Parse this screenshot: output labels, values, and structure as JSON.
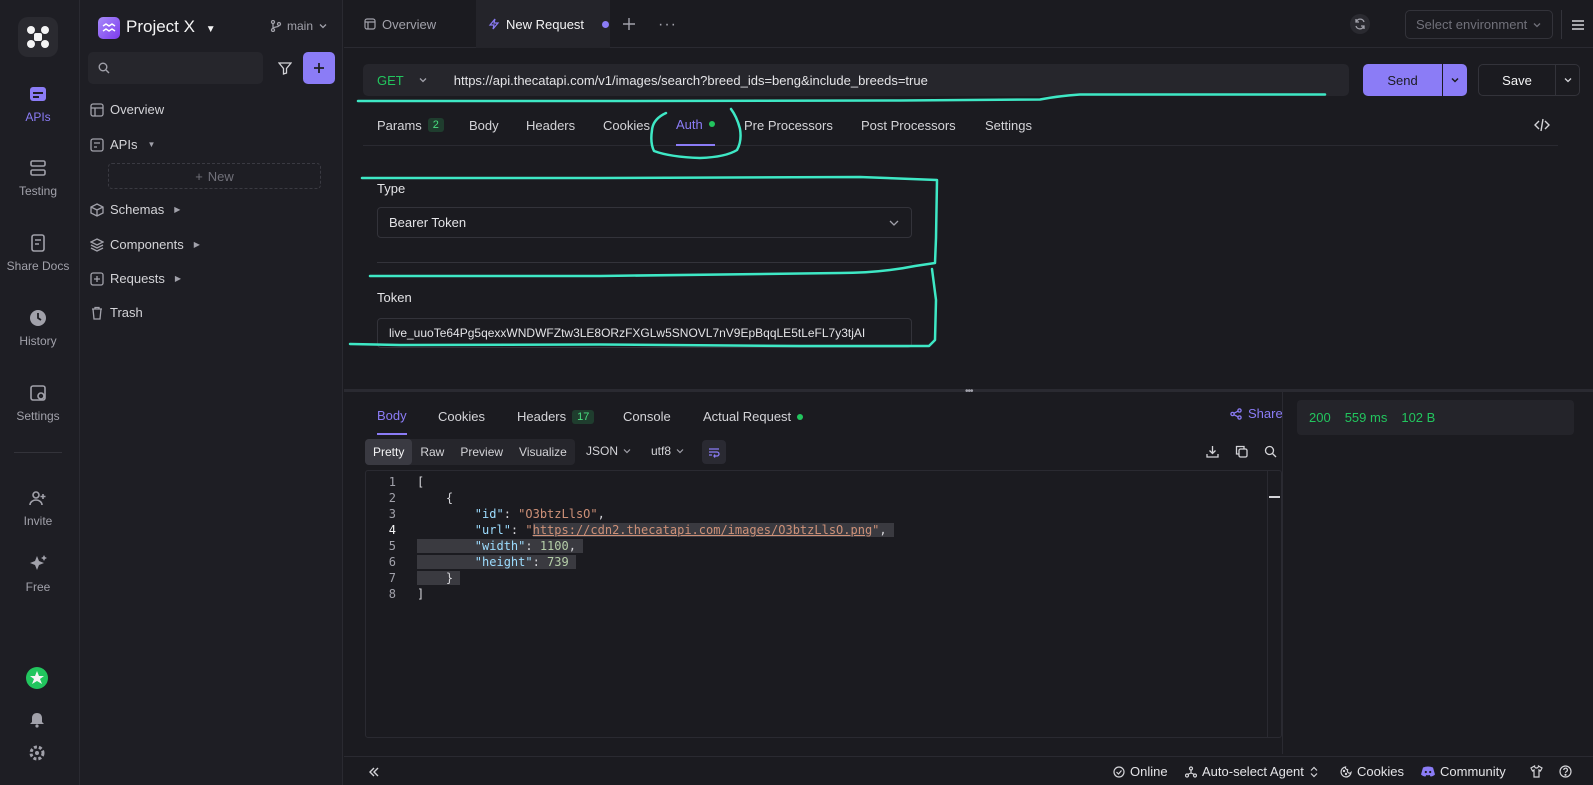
{
  "rail": {
    "items": [
      {
        "label": "APIs",
        "icon": "apis-icon",
        "active": true
      },
      {
        "label": "Testing",
        "icon": "testing-icon"
      },
      {
        "label": "Share Docs",
        "icon": "share-docs-icon"
      },
      {
        "label": "History",
        "icon": "history-icon"
      },
      {
        "label": "Settings",
        "icon": "settings-icon"
      },
      {
        "label": "Invite",
        "icon": "invite-icon"
      },
      {
        "label": "Free",
        "icon": "sparkle-icon"
      }
    ]
  },
  "sidebar": {
    "project_name": "Project X",
    "branch": "main",
    "search_placeholder": "",
    "new_label": "New",
    "items": [
      {
        "label": "Overview"
      },
      {
        "label": "APIs"
      },
      {
        "label": "Schemas"
      },
      {
        "label": "Components"
      },
      {
        "label": "Requests"
      },
      {
        "label": "Trash"
      }
    ]
  },
  "tabs": [
    {
      "label": "Overview"
    },
    {
      "label": "New Request",
      "active": true
    }
  ],
  "env_select": "Select environment",
  "request": {
    "method": "GET",
    "url": "https://api.thecatapi.com/v1/images/search?breed_ids=beng&include_breeds=true",
    "send_label": "Send",
    "save_label": "Save",
    "tabs": [
      {
        "label": "Params",
        "badge": "2"
      },
      {
        "label": "Body"
      },
      {
        "label": "Headers"
      },
      {
        "label": "Cookies"
      },
      {
        "label": "Auth",
        "active": true
      },
      {
        "label": "Pre Processors"
      },
      {
        "label": "Post Processors"
      },
      {
        "label": "Settings"
      }
    ],
    "auth": {
      "type_label": "Type",
      "type_value": "Bearer Token",
      "token_label": "Token",
      "token_value": "live_uuoTe64Pg5qexxWNDWFZtw3LE8ORzFXGLw5SNOVL7nV9EpBqqLE5tLeFL7y3tjAI"
    }
  },
  "response": {
    "tabs": [
      {
        "label": "Body",
        "active": true
      },
      {
        "label": "Cookies"
      },
      {
        "label": "Headers",
        "badge": "17"
      },
      {
        "label": "Console"
      },
      {
        "label": "Actual Request"
      }
    ],
    "share_label": "Share",
    "views": [
      "Pretty",
      "Raw",
      "Preview",
      "Visualize"
    ],
    "format": "JSON",
    "encoding": "utf8",
    "code": {
      "id_key": "\"id\"",
      "id_val": "\"O3btzLlsO\"",
      "url_key": "\"url\"",
      "url_val": "https://cdn2.thecatapi.com/images/O3btzLlsO.png",
      "width_key": "\"width\"",
      "width_val": "1100",
      "height_key": "\"height\"",
      "height_val": "739"
    },
    "status_code": "200",
    "time": "559 ms",
    "size": "102 B"
  },
  "footer": {
    "online": "Online",
    "agent": "Auto-select Agent",
    "cookies": "Cookies",
    "community": "Community"
  },
  "colors": {
    "accent": "#8b7cf6",
    "success": "#22c55e",
    "annotation": "#3ee8c5"
  }
}
